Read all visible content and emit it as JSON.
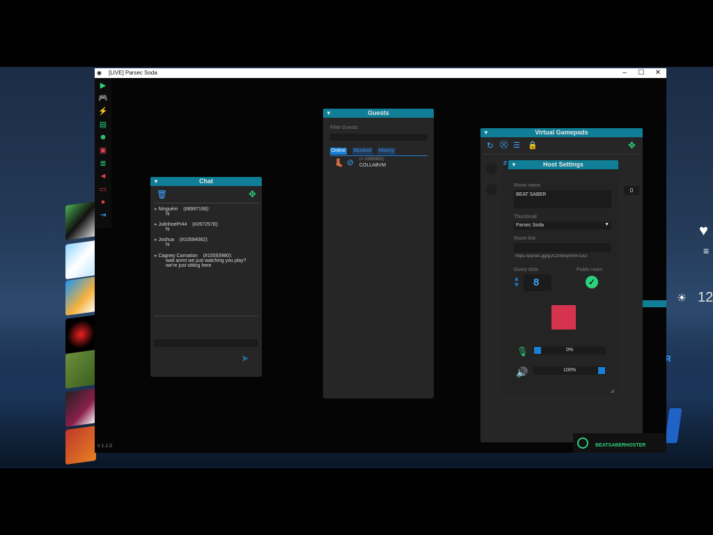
{
  "window": {
    "title": "[LIVE] Parsec Soda",
    "minimize": "–",
    "maximize": "☐",
    "close": "✕",
    "version": "v 1.1.0"
  },
  "sidebar": {
    "icons": [
      "play-icon",
      "gamepad-icon",
      "soda-logo-icon",
      "chat-icon",
      "users-icon",
      "image-icon",
      "log-icon",
      "speaker-icon",
      "monitor-icon",
      "info-icon",
      "exit-icon"
    ]
  },
  "chat": {
    "title": "Chat",
    "messages": [
      {
        "user": "Ninguém",
        "id": "(#8997168):",
        "text": "hi"
      },
      {
        "user": "JulinhoePr44",
        "id": "(#2672578):",
        "text": "hi"
      },
      {
        "user": "Joshua",
        "id": "(#10594082):",
        "text": "hi"
      },
      {
        "user": "Cagney Carnation",
        "id": "(#10593980):",
        "text": "wait arent we just watching you play? we're just sitting here"
      }
    ]
  },
  "guests": {
    "title": "Guests",
    "filter_label": "Filter Guests",
    "tabs": [
      "Online",
      "Blocked",
      "History"
    ],
    "entry": {
      "id": "(# 10595652)",
      "name": "COLLABVM"
    }
  },
  "gamepads": {
    "title": "Virtual Gamepads"
  },
  "host_settings": {
    "title": "Host Settings",
    "room_name_label": "Room name",
    "room_name_value": "BEAT SABER",
    "counter": "0",
    "thumbnail_label": "Thumbnail",
    "thumbnail_value": "Parsec Soda",
    "room_link_label": "Room link",
    "room_link_value": "https://parsec.gg/g/2Czmb3y0rxm-f1x2",
    "guest_slots_label": "Guest slots",
    "guest_slots_value": "8",
    "public_room_label": "Public room",
    "mic_level": "0%",
    "speaker_level": "100%",
    "accent_color": "#d6334f"
  },
  "game_hud": {
    "combo": "12",
    "letter": "R",
    "host_name": "BEATSABERHOSTER"
  }
}
